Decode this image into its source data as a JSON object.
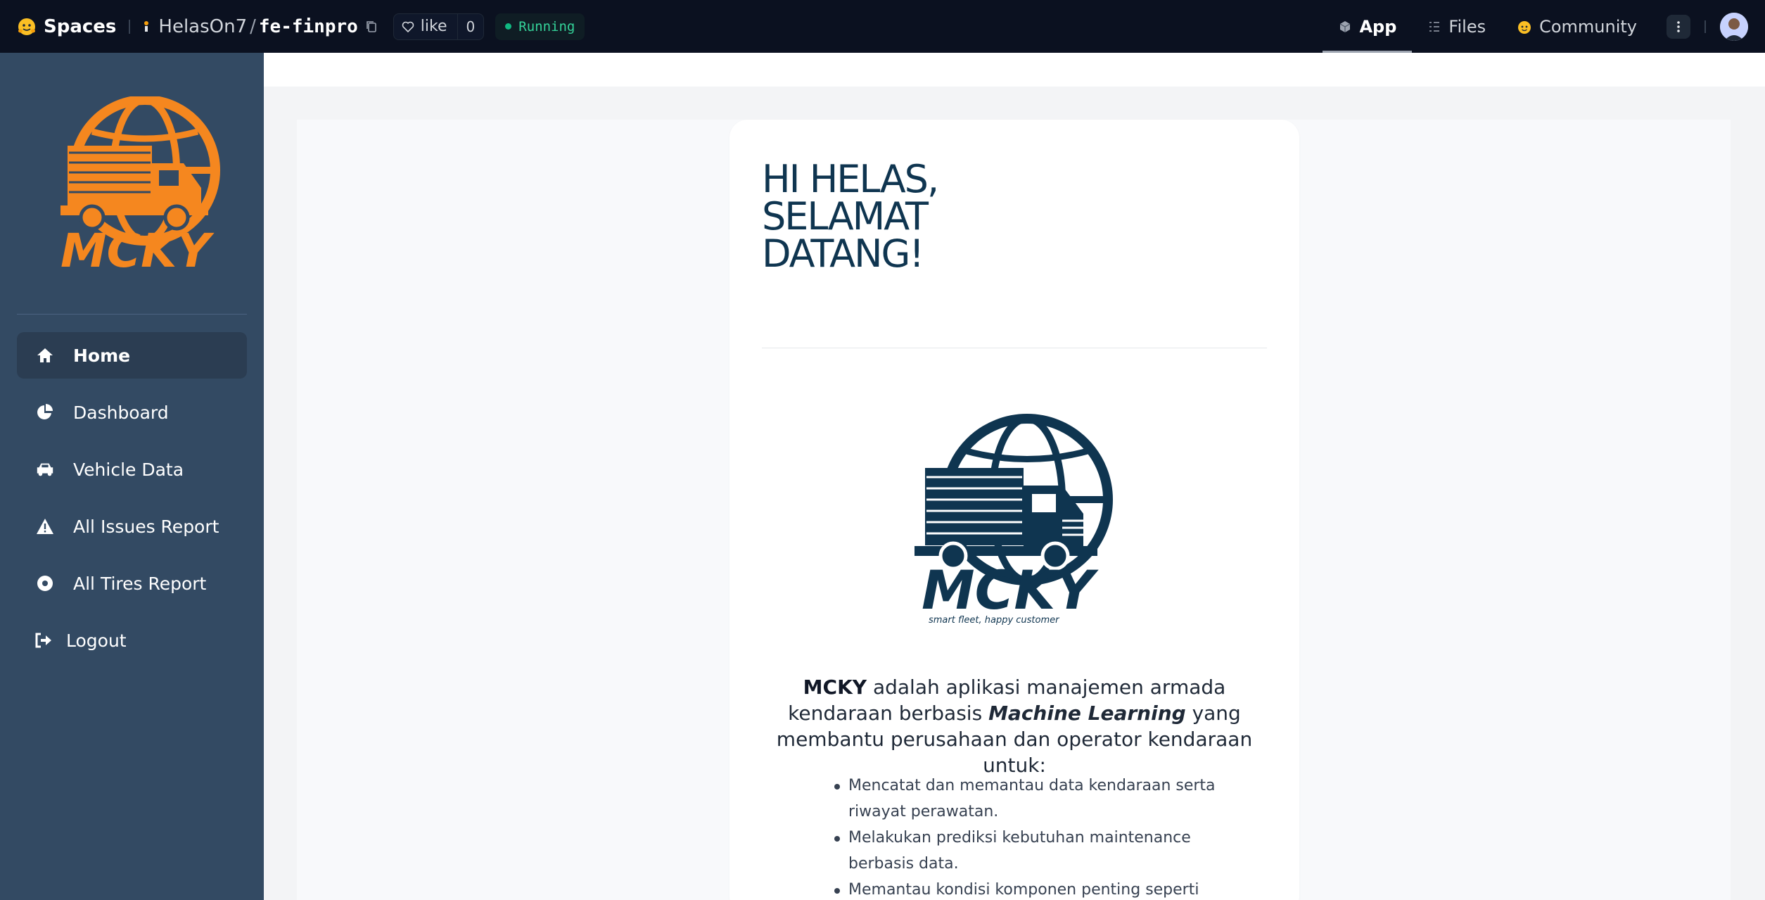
{
  "topbar": {
    "spaces_label": "Spaces",
    "owner": "HelasOn7",
    "separator": "/",
    "repo": "fe-finpro",
    "like_label": "like",
    "like_count": "0",
    "status": "Running",
    "tabs": [
      {
        "label": "App",
        "icon": "cube-icon",
        "active": true
      },
      {
        "label": "Files",
        "icon": "files-icon",
        "active": false
      },
      {
        "label": "Community",
        "icon": "community-icon",
        "active": false
      }
    ]
  },
  "sidebar": {
    "brand_text": "MCKY",
    "items": [
      {
        "label": "Home",
        "icon": "home-icon",
        "active": true
      },
      {
        "label": "Dashboard",
        "icon": "pie-chart-icon",
        "active": false
      },
      {
        "label": "Vehicle Data",
        "icon": "car-icon",
        "active": false
      },
      {
        "label": "All Issues Report",
        "icon": "warning-icon",
        "active": false
      },
      {
        "label": "All Tires Report",
        "icon": "tire-icon",
        "active": false
      },
      {
        "label": "Logout",
        "icon": "logout-icon",
        "active": false
      }
    ]
  },
  "card": {
    "greeting": "HI HELAS, SELAMAT DATANG!",
    "logo_text": "MCKY",
    "logo_tagline": "smart fleet, happy customer",
    "desc_brand": "MCKY",
    "desc_part1": " adalah aplikasi manajemen armada kendaraan berbasis ",
    "desc_emph": "Machine Learning",
    "desc_part2": " yang membantu perusahaan dan operator kendaraan untuk:",
    "features": [
      "Mencatat dan memantau data kendaraan serta riwayat perawatan.",
      "Melakukan prediksi kebutuhan maintenance berbasis data.",
      "Memantau kondisi komponen penting seperti rem,"
    ]
  },
  "colors": {
    "topbar_bg": "#0b1120",
    "sidebar_bg": "#334a63",
    "brand_orange": "#f5871f",
    "brand_navy": "#0f3550",
    "status_green": "#34d399"
  }
}
